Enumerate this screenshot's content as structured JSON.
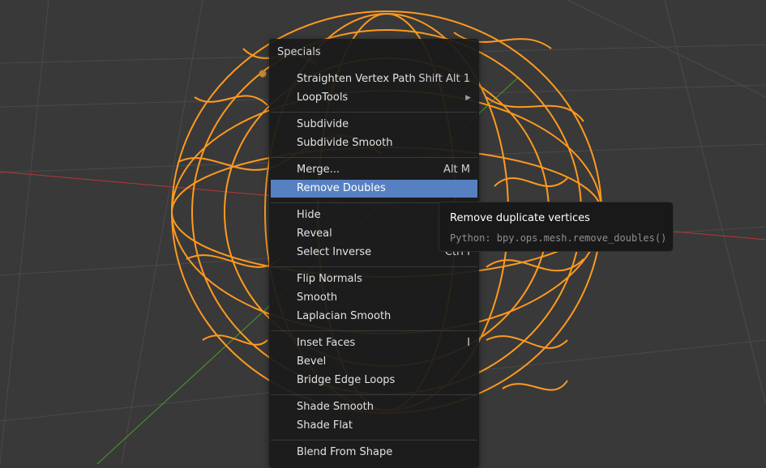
{
  "menu": {
    "title": "Specials",
    "groups": [
      [
        {
          "label": "Straighten Vertex Path",
          "shortcut": "Shift Alt 1"
        },
        {
          "label": "LoopTools",
          "submenu": true
        }
      ],
      [
        {
          "label": "Subdivide"
        },
        {
          "label": "Subdivide Smooth"
        }
      ],
      [
        {
          "label": "Merge...",
          "shortcut": "Alt M"
        },
        {
          "label": "Remove Doubles",
          "highlighted": true
        }
      ],
      [
        {
          "label": "Hide"
        },
        {
          "label": "Reveal"
        },
        {
          "label": "Select Inverse",
          "shortcut": "Ctrl I"
        }
      ],
      [
        {
          "label": "Flip Normals"
        },
        {
          "label": "Smooth"
        },
        {
          "label": "Laplacian Smooth"
        }
      ],
      [
        {
          "label": "Inset Faces",
          "shortcut": "I"
        },
        {
          "label": "Bevel"
        },
        {
          "label": "Bridge Edge Loops"
        }
      ],
      [
        {
          "label": "Shade Smooth"
        },
        {
          "label": "Shade Flat"
        }
      ],
      [
        {
          "label": "Blend From Shape"
        }
      ]
    ]
  },
  "tooltip": {
    "title": "Remove duplicate vertices",
    "python": "Python: bpy.ops.mesh.remove_doubles()"
  },
  "colors": {
    "mesh": "#ff9a1f",
    "highlight": "#5680c2",
    "x_axis": "#b83636",
    "y_axis": "#4e9b2f"
  },
  "icons": {
    "submenu": "triangle-right-icon"
  }
}
